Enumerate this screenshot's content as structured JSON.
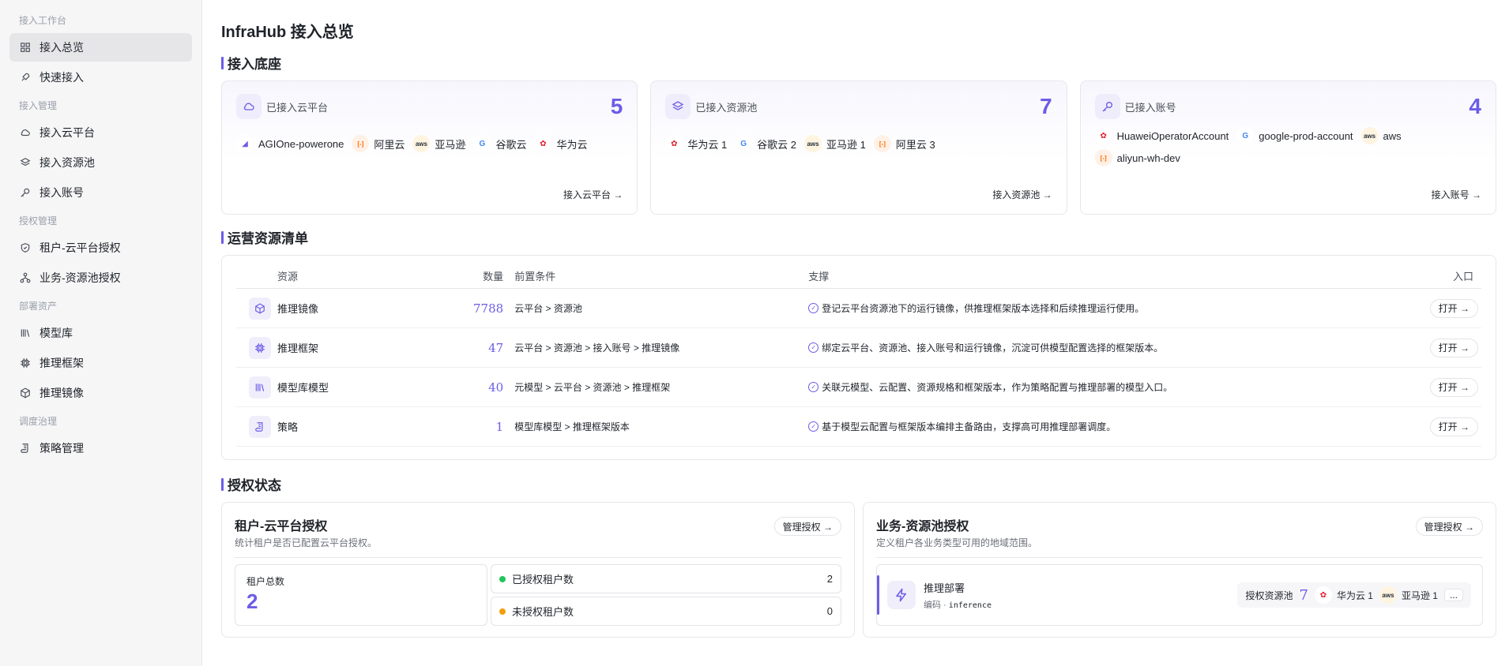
{
  "sidebar": {
    "groups": [
      {
        "title": "接入工作台",
        "items": [
          {
            "label": "接入总览",
            "icon": "grid-icon",
            "active": true
          },
          {
            "label": "快速接入",
            "icon": "rocket-icon"
          }
        ]
      },
      {
        "title": "接入管理",
        "items": [
          {
            "label": "接入云平台",
            "icon": "cloud-icon"
          },
          {
            "label": "接入资源池",
            "icon": "layers-icon"
          },
          {
            "label": "接入账号",
            "icon": "key-icon"
          }
        ]
      },
      {
        "title": "授权管理",
        "items": [
          {
            "label": "租户-云平台授权",
            "icon": "shield-icon"
          },
          {
            "label": "业务-资源池授权",
            "icon": "sitemap-icon"
          }
        ]
      },
      {
        "title": "部署资产",
        "items": [
          {
            "label": "模型库",
            "icon": "library-icon"
          },
          {
            "label": "推理框架",
            "icon": "chip-icon"
          },
          {
            "label": "推理镜像",
            "icon": "cube-icon"
          }
        ]
      },
      {
        "title": "调度治理",
        "items": [
          {
            "label": "策略管理",
            "icon": "scroll-icon"
          }
        ]
      }
    ]
  },
  "page_title": "InfraHub 接入总览",
  "base": {
    "title": "接入底座",
    "cards": [
      {
        "label": "已接入云平台",
        "count": "5",
        "icon": "cloud-icon",
        "link": "接入云平台 →",
        "chips": [
          {
            "name": "AGIOne-powerone",
            "brand": "agione"
          },
          {
            "name": "阿里云",
            "brand": "aliyun"
          },
          {
            "name": "亚马逊",
            "brand": "aws"
          },
          {
            "name": "谷歌云",
            "brand": "google"
          },
          {
            "name": "华为云",
            "brand": "huawei"
          }
        ]
      },
      {
        "label": "已接入资源池",
        "count": "7",
        "icon": "layers-icon",
        "link": "接入资源池 →",
        "chips": [
          {
            "name": "华为云 1",
            "brand": "huawei"
          },
          {
            "name": "谷歌云 2",
            "brand": "google"
          },
          {
            "name": "亚马逊 1",
            "brand": "aws"
          },
          {
            "name": "阿里云 3",
            "brand": "aliyun"
          }
        ]
      },
      {
        "label": "已接入账号",
        "count": "4",
        "icon": "key-icon",
        "link": "接入账号 →",
        "chips": [
          {
            "name": "HuaweiOperatorAccount",
            "brand": "huawei"
          },
          {
            "name": "google-prod-account",
            "brand": "google"
          },
          {
            "name": "aws",
            "brand": "aws"
          },
          {
            "name": "aliyun-wh-dev",
            "brand": "aliyun"
          }
        ]
      }
    ]
  },
  "resources": {
    "title": "运营资源清单",
    "columns": [
      "资源",
      "数量",
      "前置条件",
      "支撑",
      "入口"
    ],
    "rows": [
      {
        "name": "推理镜像",
        "icon": "cube-icon",
        "count": "7788",
        "pre": "云平台 > 资源池",
        "support": "登记云平台资源池下的运行镜像，供推理框架版本选择和后续推理运行使用。",
        "action": "打开 →"
      },
      {
        "name": "推理框架",
        "icon": "chip-icon",
        "count": "47",
        "pre": "云平台 > 资源池 > 接入账号 > 推理镜像",
        "support": "绑定云平台、资源池、接入账号和运行镜像，沉淀可供模型配置选择的框架版本。",
        "action": "打开 →"
      },
      {
        "name": "模型库模型",
        "icon": "library-icon",
        "count": "40",
        "pre": "元模型 > 云平台 > 资源池 > 推理框架",
        "support": "关联元模型、云配置、资源规格和框架版本，作为策略配置与推理部署的模型入口。",
        "action": "打开 →"
      },
      {
        "name": "策略",
        "icon": "scroll-icon",
        "count": "1",
        "pre": "模型库模型 > 推理框架版本",
        "support": "基于模型云配置与框架版本编排主备路由，支撑高可用推理部署调度。",
        "action": "打开 →"
      }
    ]
  },
  "auth": {
    "title": "授权状态",
    "tenant": {
      "title": "租户-云平台授权",
      "subtitle": "统计租户是否已配置云平台授权。",
      "manage": "管理授权 →",
      "total_label": "租户总数",
      "total": "2",
      "authorized_label": "已授权租户数",
      "authorized": "2",
      "unauthorized_label": "未授权租户数",
      "unauthorized": "0",
      "colors": {
        "authorized": "#22c55e",
        "unauthorized": "#f59e0b"
      }
    },
    "business": {
      "title": "业务-资源池授权",
      "subtitle": "定义租户各业务类型可用的地域范围。",
      "manage": "管理授权 →",
      "pool_name": "推理部署",
      "code_label": "编码 ·",
      "code": "inference",
      "pool_label": "授权资源池",
      "pool_count": "7",
      "pool_chips": [
        {
          "name": "华为云 1",
          "brand": "huawei"
        },
        {
          "name": "亚马逊 1",
          "brand": "aws"
        }
      ],
      "more": "..."
    }
  },
  "accent_color": "#6c5ce7"
}
